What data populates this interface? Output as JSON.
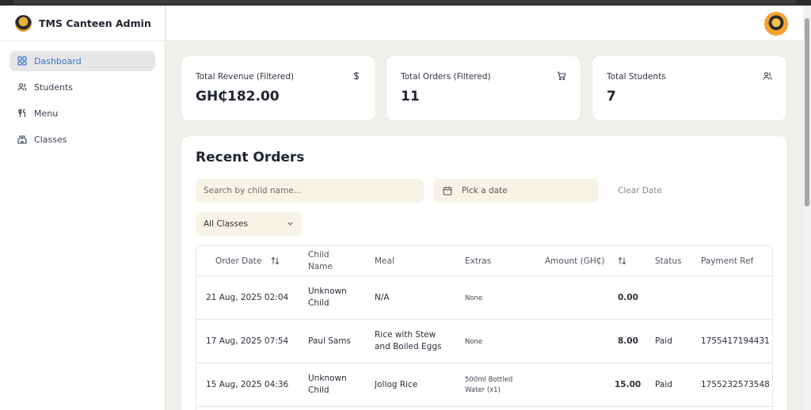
{
  "app": {
    "title": "TMS Canteen Admin"
  },
  "sidebar": {
    "items": [
      {
        "label": "Dashboard",
        "icon": "dashboard-icon",
        "active": true
      },
      {
        "label": "Students",
        "icon": "users-icon",
        "active": false
      },
      {
        "label": "Menu",
        "icon": "utensils-icon",
        "active": false
      },
      {
        "label": "Classes",
        "icon": "school-icon",
        "active": false
      }
    ]
  },
  "cards": [
    {
      "label": "Total Revenue (Filtered)",
      "value": "GH₵182.00",
      "icon": "dollar-icon"
    },
    {
      "label": "Total Orders (Filtered)",
      "value": "11",
      "icon": "cart-icon"
    },
    {
      "label": "Total Students",
      "value": "7",
      "icon": "users-icon"
    }
  ],
  "orders": {
    "title": "Recent Orders",
    "search_placeholder": "Search by child name...",
    "date_placeholder": "Pick a date",
    "clear_date": "Clear Date",
    "class_filter": "All Classes",
    "columns": {
      "order_date": "Order Date",
      "child_name_1": "Child",
      "child_name_2": "Name",
      "meal": "Meal",
      "extras": "Extras",
      "amount": "Amount (GH₵)",
      "status": "Status",
      "payment_ref": "Payment Ref"
    },
    "rows": [
      {
        "date": "21 Aug, 2025 02:04",
        "child1": "Unknown",
        "child2": "Child",
        "meal1": "N/A",
        "meal2": "",
        "extras1": "None",
        "extras2": "",
        "amount": "0.00",
        "status": "",
        "ref": ""
      },
      {
        "date": "17 Aug, 2025 07:54",
        "child1": "Paul Sams",
        "child2": "",
        "meal1": "Rice with Stew",
        "meal2": "and Boiled Eggs",
        "extras1": "None",
        "extras2": "",
        "amount": "8.00",
        "status": "Paid",
        "ref": "1755417194431"
      },
      {
        "date": "15 Aug, 2025 04:36",
        "child1": "Unknown",
        "child2": "Child",
        "meal1": "Jollog Rice",
        "meal2": "",
        "extras1": "500ml Bottled",
        "extras2": "Water (x1)",
        "amount": "15.00",
        "status": "Paid",
        "ref": "1755232573548"
      }
    ]
  },
  "colors": {
    "accent": "#3b74c5",
    "input_bg": "#f7f4e7",
    "page_bg": "#f0efea"
  }
}
